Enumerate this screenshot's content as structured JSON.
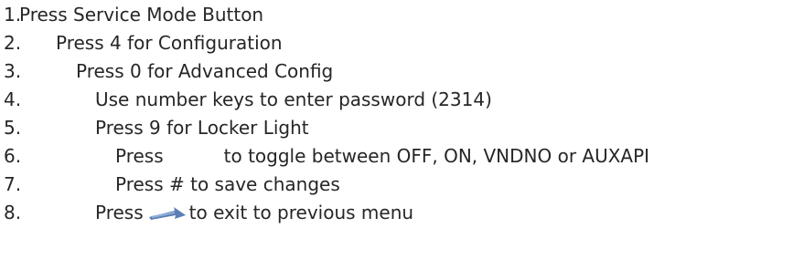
{
  "steps": [
    {
      "number": "1.",
      "text": "Press Service Mode Button"
    },
    {
      "number": "2.",
      "text": "Press 4 for Configuration"
    },
    {
      "number": "3.",
      "text": "Press 0 for Advanced Config"
    },
    {
      "number": "4.",
      "text": "Use number keys to enter password (2314)"
    },
    {
      "number": "5.",
      "text": "Press 9 for Locker Light"
    },
    {
      "number": "6.",
      "text_before": "Press",
      "text_after": "to toggle between OFF, ON, VNDNO or AUXAPI"
    },
    {
      "number": "7.",
      "text": "Press # to save changes"
    },
    {
      "number": "8.",
      "text_before": "Press",
      "icon": "back-arrow-icon",
      "text_after": "to exit to previous menu"
    }
  ],
  "colors": {
    "text": "#262626",
    "icon": "#5b7fb5"
  }
}
